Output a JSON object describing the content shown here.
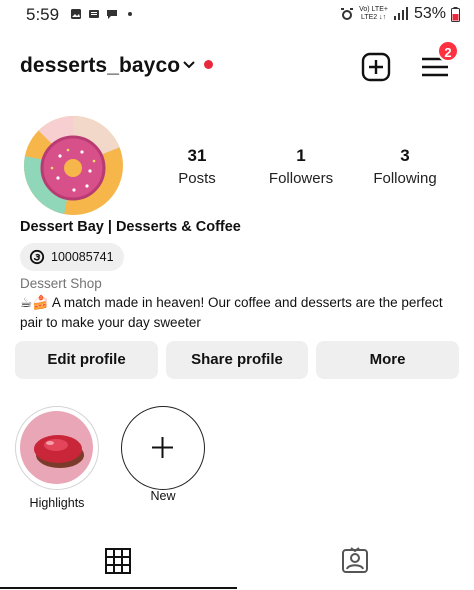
{
  "status_bar": {
    "time": "5:59",
    "network_line1": "Vo) LTE+",
    "network_line2": "LTE2 ↓↑",
    "battery": "53%"
  },
  "header": {
    "username": "desserts_bayco",
    "notification_count": "2"
  },
  "profile": {
    "stats": [
      {
        "value": "31",
        "label": "Posts"
      },
      {
        "value": "1",
        "label": "Followers"
      },
      {
        "value": "3",
        "label": "Following"
      }
    ],
    "display_name": "Dessert Bay | Desserts & Coffee",
    "threads_handle": "100085741",
    "category": "Dessert Shop",
    "bio": "☕🍰 A match made in heaven! Our coffee and desserts are the perfect pair to make your day sweeter"
  },
  "buttons": {
    "edit": "Edit profile",
    "share": "Share profile",
    "more": "More"
  },
  "highlights": [
    {
      "label": "Highlights"
    },
    {
      "label": "New"
    }
  ],
  "colors": {
    "accent_red": "#ff3040",
    "button_bg": "#efefef"
  }
}
